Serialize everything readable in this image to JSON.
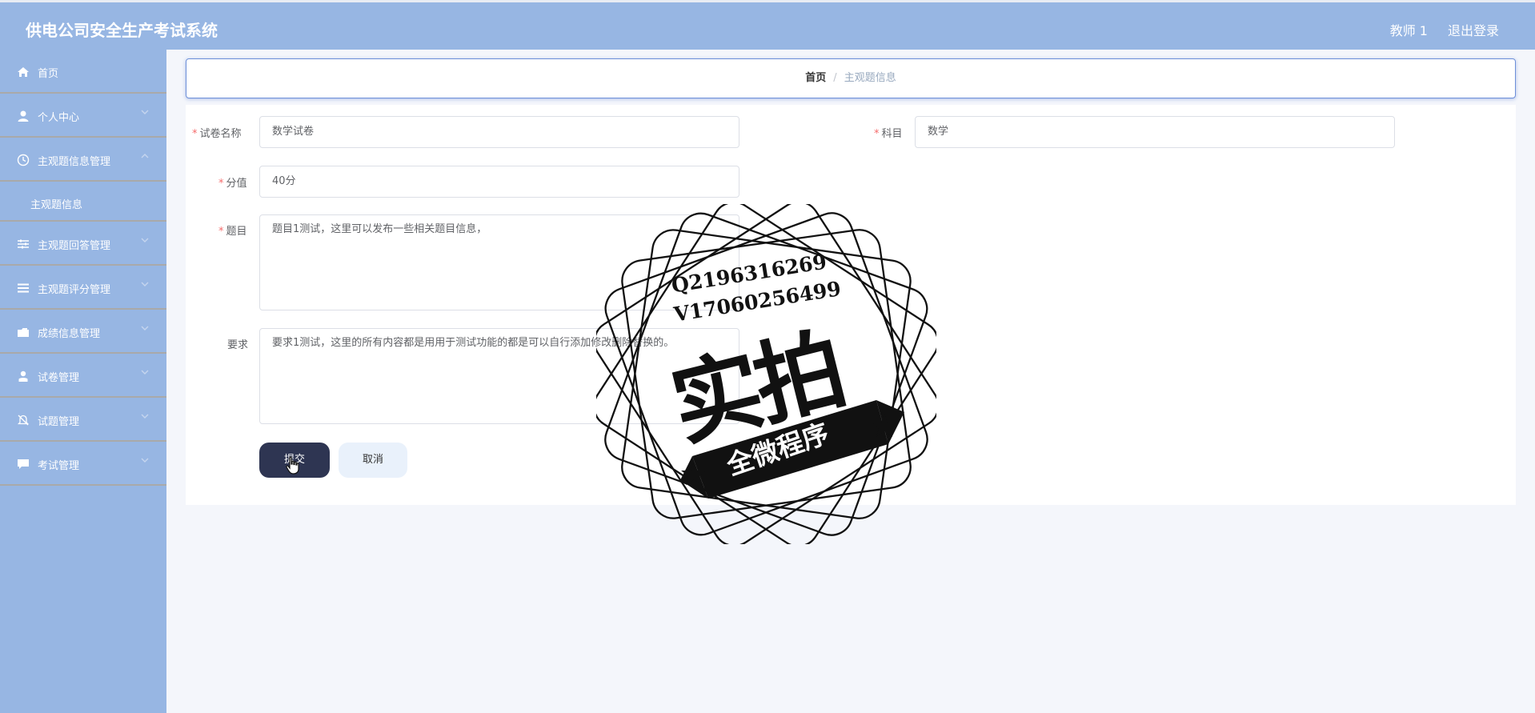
{
  "header": {
    "title": "供电公司安全生产考试系统",
    "user": "教师 1",
    "logout": "退出登录"
  },
  "sidebar": {
    "items": [
      {
        "label": "首页",
        "icon": "home-icon"
      },
      {
        "label": "个人中心",
        "icon": "user-icon"
      },
      {
        "label": "主观题信息管理",
        "icon": "clock-icon"
      },
      {
        "label": "主观题信息",
        "sub": true
      },
      {
        "label": "主观题回答管理",
        "icon": "sliders-icon"
      },
      {
        "label": "主观题评分管理",
        "icon": "list-icon"
      },
      {
        "label": "成绩信息管理",
        "icon": "folder-icon"
      },
      {
        "label": "试卷管理",
        "icon": "person-icon"
      },
      {
        "label": "试题管理",
        "icon": "bell-off-icon"
      },
      {
        "label": "考试管理",
        "icon": "chat-icon"
      }
    ]
  },
  "breadcrumb": {
    "home": "首页",
    "sep": "/",
    "current": "主观题信息"
  },
  "form": {
    "paper_name_label": "试卷名称",
    "paper_name_value": "数学试卷",
    "subject_label": "科目",
    "subject_value": "数学",
    "score_label": "分值",
    "score_value": "40分",
    "question_label": "题目",
    "question_value": "题目1测试，这里可以发布一些相关题目信息，",
    "requirement_label": "要求",
    "requirement_value": "要求1测试，这里的所有内容都是用用于测试功能的都是可以自行添加修改删除替换的。",
    "submit": "提交",
    "cancel": "取消"
  },
  "watermark": {
    "qq": "Q2196316269",
    "v": "V17060256499",
    "big": "实拍",
    "banner": "全微程序"
  },
  "colors": {
    "header": "#97b6e3",
    "sidebar": "#97b6e3",
    "submit": "#2e3552",
    "required": "#f56c6c"
  }
}
